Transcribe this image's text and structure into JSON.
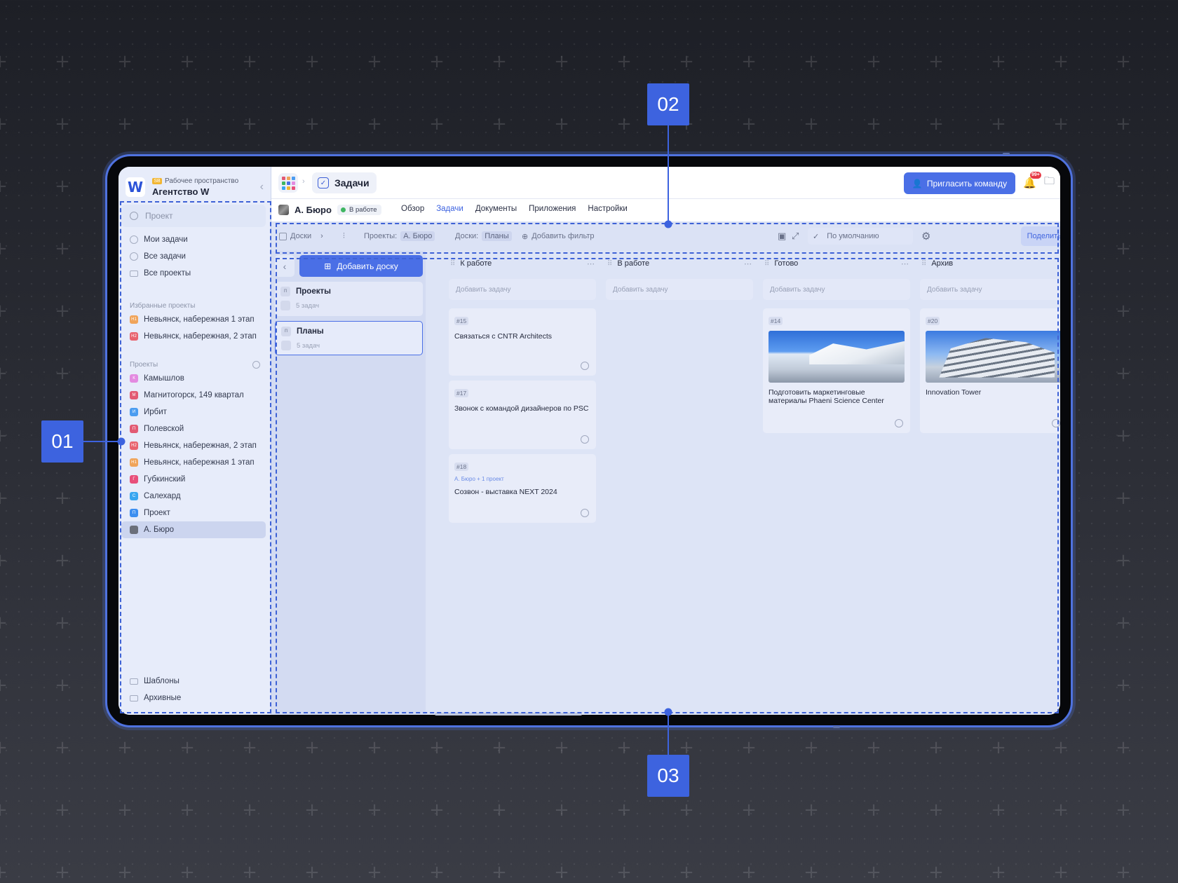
{
  "workspace": {
    "badge": "SB",
    "label": "Рабочее пространство",
    "name": "Агентство W",
    "logo": "W"
  },
  "sidebar": {
    "search_placeholder": "Проект",
    "nav": [
      "Мои задачи",
      "Все задачи",
      "Все проекты"
    ],
    "favorites_title": "Избранные проекты",
    "favorites": [
      {
        "label": "Невьянск, набережная 1 этап",
        "abbr": "Н1",
        "color": "#f0a45a"
      },
      {
        "label": "Невьянск, набережная, 2 этап",
        "abbr": "Н2",
        "color": "#e8646f"
      }
    ],
    "projects_title": "Проекты",
    "projects": [
      {
        "label": "Камышлов",
        "abbr": "К",
        "color": "#e38ae0"
      },
      {
        "label": "Магнитогорск, 149 квартал",
        "abbr": "М",
        "color": "#e25a73"
      },
      {
        "label": "Ирбит",
        "abbr": "И",
        "color": "#4b9cf0"
      },
      {
        "label": "Полевской",
        "abbr": "П",
        "color": "#e25a73"
      },
      {
        "label": "Невьянск, набережная, 2 этап",
        "abbr": "Н2",
        "color": "#e8646f"
      },
      {
        "label": "Невьянск, набережная 1 этап",
        "abbr": "Н1",
        "color": "#f0a45a"
      },
      {
        "label": "Губкинский",
        "abbr": "Г",
        "color": "#e84f7a"
      },
      {
        "label": "Салехард",
        "abbr": "С",
        "color": "#39a6f0"
      },
      {
        "label": "Проект",
        "abbr": "П",
        "color": "#3c8ef0"
      },
      {
        "label": "А. Бюро",
        "abbr": "",
        "color": "#6b6f7a"
      }
    ],
    "templates": "Шаблоны",
    "archived": "Архивные"
  },
  "topbar": {
    "section": "Задачи",
    "invite": "Пригласить команду",
    "notifications_badge": "99+"
  },
  "project": {
    "name": "А. Бюро",
    "status": "В работе",
    "tabs": [
      "Обзор",
      "Задачи",
      "Документы",
      "Приложения",
      "Настройки"
    ],
    "active_tab": "Задачи"
  },
  "filters": {
    "boards": "Доски",
    "projects_label": "Проекты:",
    "projects_value": "А. Бюро",
    "boards_label": "Доски:",
    "boards_value": "Планы",
    "add_filter": "Добавить фильтр",
    "view": "По умолчанию",
    "share": "Поделиться"
  },
  "boards_panel": {
    "add_board": "Добавить доску",
    "boards": [
      {
        "name": "Проекты",
        "count": "5 задач",
        "abbr": "П"
      },
      {
        "name": "Планы",
        "count": "5 задач",
        "abbr": "П"
      }
    ]
  },
  "add_task": "Добавить задачу",
  "columns": [
    {
      "title": "К работе",
      "cards": [
        {
          "id": "#15",
          "title": "Связаться с CNTR Architects"
        },
        {
          "id": "#17",
          "title": "Звонок с командой дизайнеров по PSC"
        },
        {
          "id": "#18",
          "meta": "А. Бюро + 1 проект",
          "title": "Созвон - выставка NEXT 2024"
        }
      ]
    },
    {
      "title": "В работе",
      "cards": []
    },
    {
      "title": "Готово",
      "cards": [
        {
          "id": "#14",
          "title": "Подготовить маркетинговые материалы Phaeni Science Center",
          "image": "building-photo"
        }
      ]
    },
    {
      "title": "Архив",
      "cards": [
        {
          "id": "#20",
          "title": "Innovation Tower",
          "image": "tower-photo"
        }
      ]
    }
  ],
  "annotations": [
    "01",
    "02",
    "03"
  ],
  "colors": {
    "accent": "#4a6fe6",
    "annotation": "#3d63df",
    "status_green": "#3fb662"
  }
}
